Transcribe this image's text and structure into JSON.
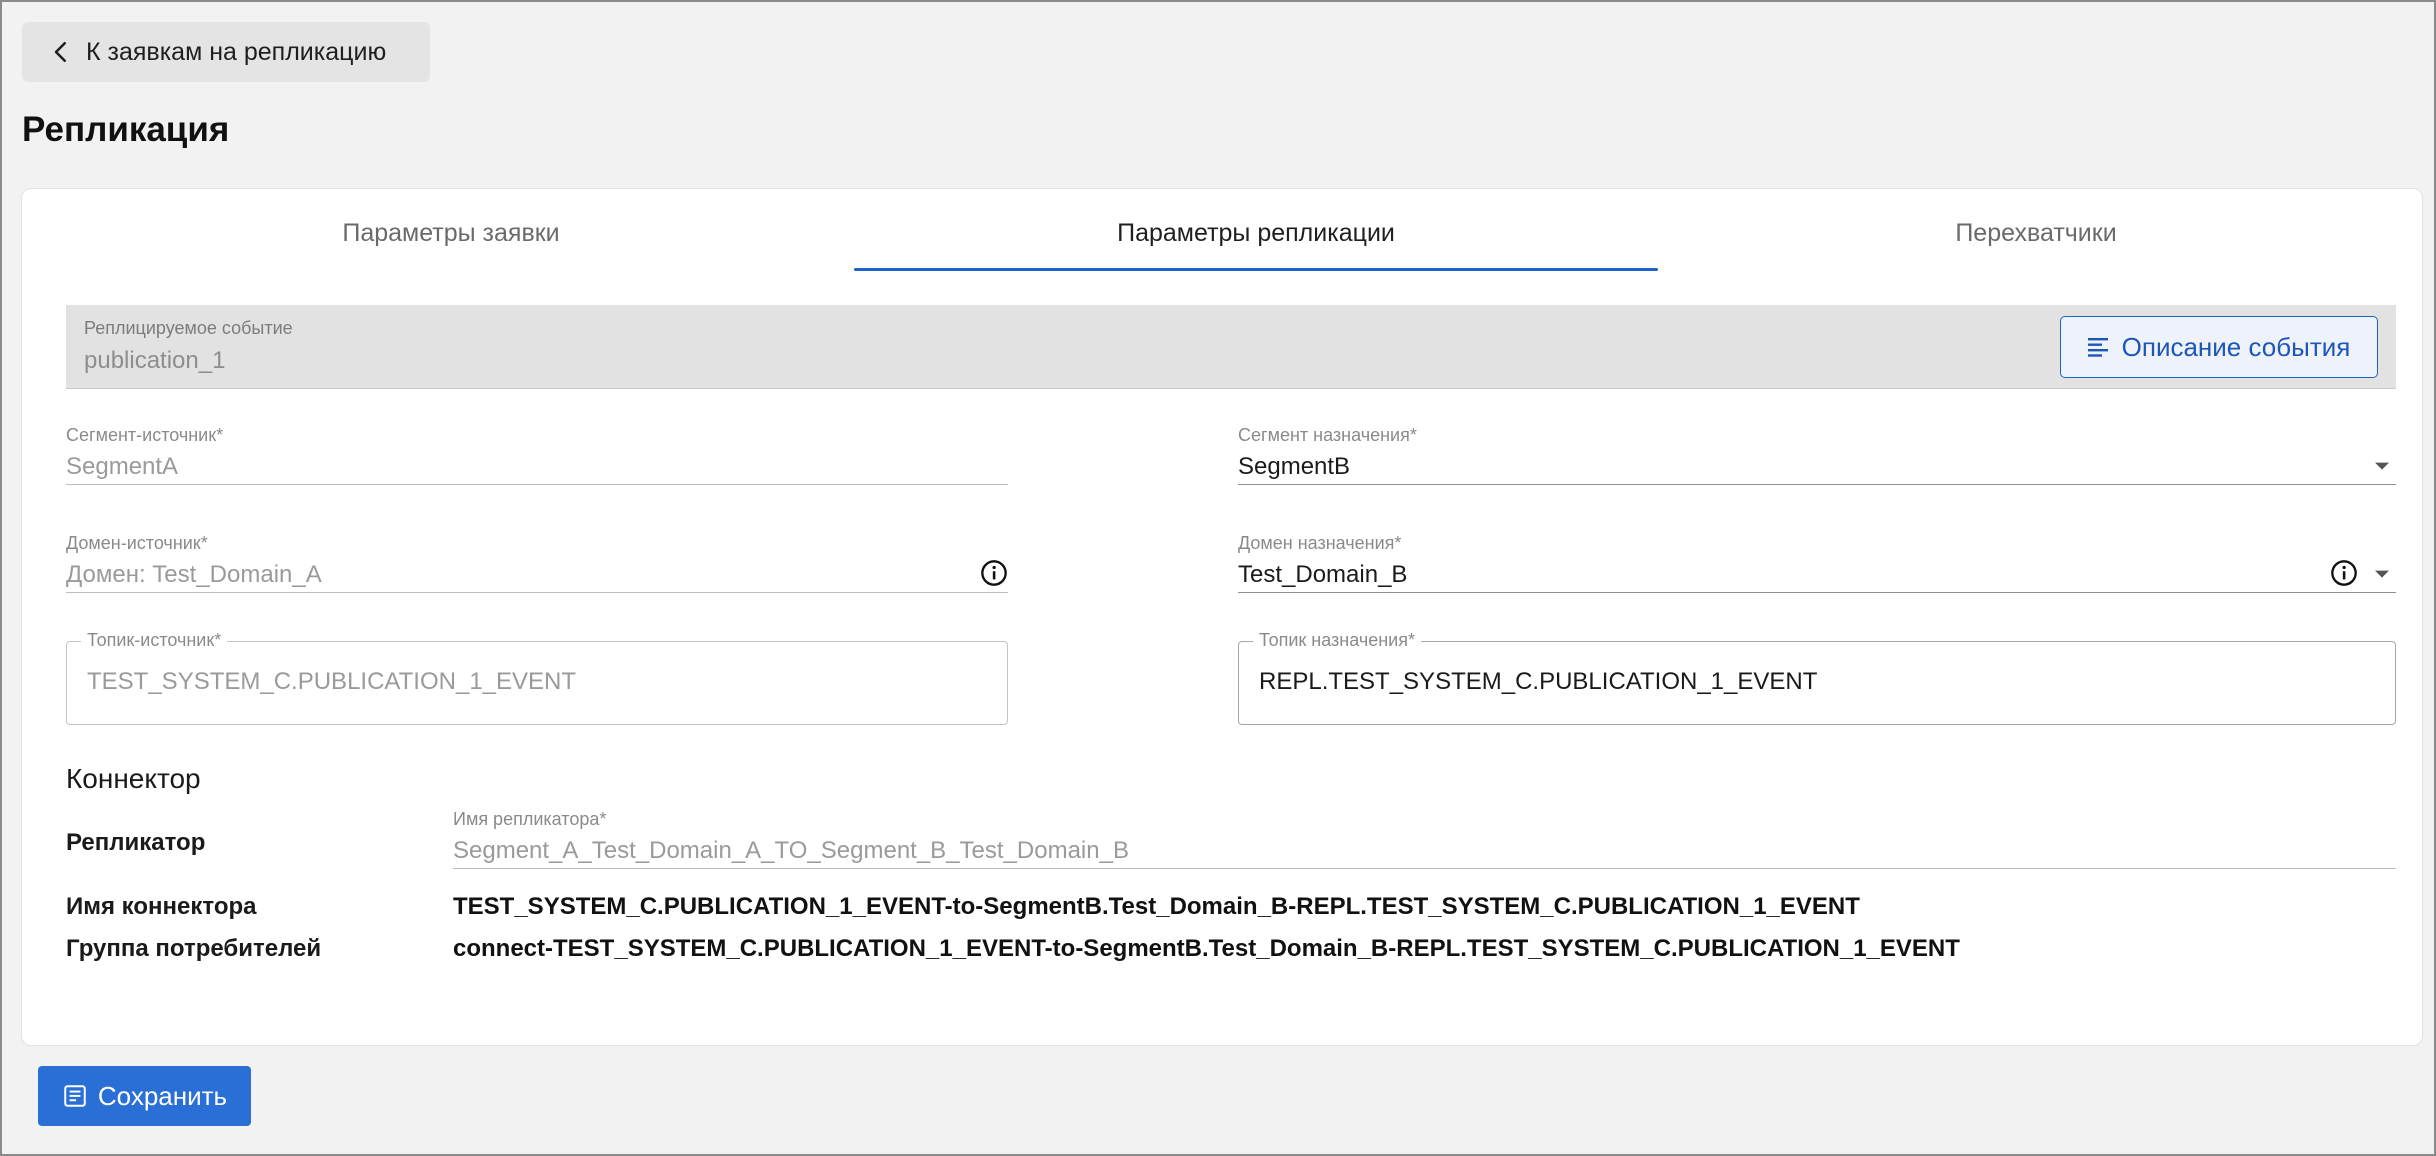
{
  "back_button": {
    "label": "К заявкам на репликацию"
  },
  "page_title": "Репликация",
  "tabs": [
    {
      "label": "Параметры заявки",
      "active": false
    },
    {
      "label": "Параметры репликации",
      "active": true
    },
    {
      "label": "Перехватчики",
      "active": false
    }
  ],
  "event": {
    "label": "Реплицируемое событие",
    "value": "publication_1",
    "describe_button": "Описание события"
  },
  "source": {
    "segment": {
      "label": "Сегмент-источник",
      "value": "SegmentA"
    },
    "domain": {
      "label": "Домен-источник",
      "value": "Домен: Test_Domain_A"
    },
    "topic": {
      "label": "Топик-источник",
      "value": "TEST_SYSTEM_C.PUBLICATION_1_EVENT"
    }
  },
  "target": {
    "segment": {
      "label": "Сегмент назначения",
      "value": "SegmentB"
    },
    "domain": {
      "label": "Домен назначения",
      "value": "Test_Domain_B"
    },
    "topic": {
      "label": "Топик назначения",
      "value": "REPL.TEST_SYSTEM_C.PUBLICATION_1_EVENT"
    }
  },
  "required_mark": "*",
  "connector": {
    "title": "Коннектор",
    "replicator_label": "Репликатор",
    "replicator_field_label": "Имя репликатора",
    "replicator_value": "Segment_A_Test_Domain_A_TO_Segment_B_Test_Domain_B",
    "connector_name_label": "Имя коннектора",
    "connector_name_value": "TEST_SYSTEM_C.PUBLICATION_1_EVENT-to-SegmentB.Test_Domain_B-REPL.TEST_SYSTEM_C.PUBLICATION_1_EVENT",
    "consumer_group_label": "Группа потребителей",
    "consumer_group_value": "connect-TEST_SYSTEM_C.PUBLICATION_1_EVENT-to-SegmentB.Test_Domain_B-REPL.TEST_SYSTEM_C.PUBLICATION_1_EVENT"
  },
  "save_button": {
    "label": "Сохранить"
  },
  "colors": {
    "accent": "#1e63c7",
    "save_button": "#2a6fd6",
    "page_background": "#f2f2f2",
    "event_box_background": "#e2e2e2"
  },
  "icons": {
    "back": "chevron-left-icon",
    "describe": "lines-icon",
    "info": "info-circle-icon",
    "dropdown": "caret-down-icon",
    "save": "save-icon"
  }
}
